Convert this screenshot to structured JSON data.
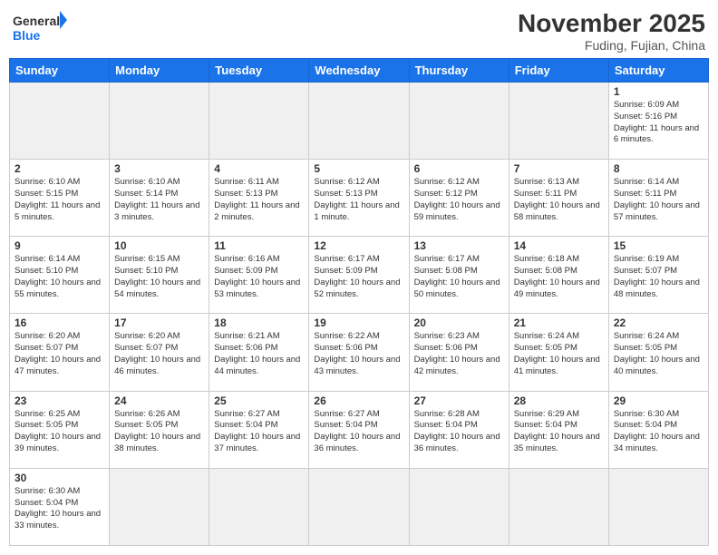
{
  "header": {
    "logo_general": "General",
    "logo_blue": "Blue",
    "month_title": "November 2025",
    "location": "Fuding, Fujian, China"
  },
  "weekdays": [
    "Sunday",
    "Monday",
    "Tuesday",
    "Wednesday",
    "Thursday",
    "Friday",
    "Saturday"
  ],
  "weeks": [
    [
      {
        "day": "",
        "info": "",
        "gray": true
      },
      {
        "day": "",
        "info": "",
        "gray": true
      },
      {
        "day": "",
        "info": "",
        "gray": true
      },
      {
        "day": "",
        "info": "",
        "gray": true
      },
      {
        "day": "",
        "info": "",
        "gray": true
      },
      {
        "day": "",
        "info": "",
        "gray": true
      },
      {
        "day": "1",
        "info": "Sunrise: 6:09 AM\nSunset: 5:16 PM\nDaylight: 11 hours and 6 minutes.",
        "gray": false
      }
    ],
    [
      {
        "day": "2",
        "info": "Sunrise: 6:10 AM\nSunset: 5:15 PM\nDaylight: 11 hours and 5 minutes.",
        "gray": false
      },
      {
        "day": "3",
        "info": "Sunrise: 6:10 AM\nSunset: 5:14 PM\nDaylight: 11 hours and 3 minutes.",
        "gray": false
      },
      {
        "day": "4",
        "info": "Sunrise: 6:11 AM\nSunset: 5:13 PM\nDaylight: 11 hours and 2 minutes.",
        "gray": false
      },
      {
        "day": "5",
        "info": "Sunrise: 6:12 AM\nSunset: 5:13 PM\nDaylight: 11 hours and 1 minute.",
        "gray": false
      },
      {
        "day": "6",
        "info": "Sunrise: 6:12 AM\nSunset: 5:12 PM\nDaylight: 10 hours and 59 minutes.",
        "gray": false
      },
      {
        "day": "7",
        "info": "Sunrise: 6:13 AM\nSunset: 5:11 PM\nDaylight: 10 hours and 58 minutes.",
        "gray": false
      },
      {
        "day": "8",
        "info": "Sunrise: 6:14 AM\nSunset: 5:11 PM\nDaylight: 10 hours and 57 minutes.",
        "gray": false
      }
    ],
    [
      {
        "day": "9",
        "info": "Sunrise: 6:14 AM\nSunset: 5:10 PM\nDaylight: 10 hours and 55 minutes.",
        "gray": false
      },
      {
        "day": "10",
        "info": "Sunrise: 6:15 AM\nSunset: 5:10 PM\nDaylight: 10 hours and 54 minutes.",
        "gray": false
      },
      {
        "day": "11",
        "info": "Sunrise: 6:16 AM\nSunset: 5:09 PM\nDaylight: 10 hours and 53 minutes.",
        "gray": false
      },
      {
        "day": "12",
        "info": "Sunrise: 6:17 AM\nSunset: 5:09 PM\nDaylight: 10 hours and 52 minutes.",
        "gray": false
      },
      {
        "day": "13",
        "info": "Sunrise: 6:17 AM\nSunset: 5:08 PM\nDaylight: 10 hours and 50 minutes.",
        "gray": false
      },
      {
        "day": "14",
        "info": "Sunrise: 6:18 AM\nSunset: 5:08 PM\nDaylight: 10 hours and 49 minutes.",
        "gray": false
      },
      {
        "day": "15",
        "info": "Sunrise: 6:19 AM\nSunset: 5:07 PM\nDaylight: 10 hours and 48 minutes.",
        "gray": false
      }
    ],
    [
      {
        "day": "16",
        "info": "Sunrise: 6:20 AM\nSunset: 5:07 PM\nDaylight: 10 hours and 47 minutes.",
        "gray": false
      },
      {
        "day": "17",
        "info": "Sunrise: 6:20 AM\nSunset: 5:07 PM\nDaylight: 10 hours and 46 minutes.",
        "gray": false
      },
      {
        "day": "18",
        "info": "Sunrise: 6:21 AM\nSunset: 5:06 PM\nDaylight: 10 hours and 44 minutes.",
        "gray": false
      },
      {
        "day": "19",
        "info": "Sunrise: 6:22 AM\nSunset: 5:06 PM\nDaylight: 10 hours and 43 minutes.",
        "gray": false
      },
      {
        "day": "20",
        "info": "Sunrise: 6:23 AM\nSunset: 5:06 PM\nDaylight: 10 hours and 42 minutes.",
        "gray": false
      },
      {
        "day": "21",
        "info": "Sunrise: 6:24 AM\nSunset: 5:05 PM\nDaylight: 10 hours and 41 minutes.",
        "gray": false
      },
      {
        "day": "22",
        "info": "Sunrise: 6:24 AM\nSunset: 5:05 PM\nDaylight: 10 hours and 40 minutes.",
        "gray": false
      }
    ],
    [
      {
        "day": "23",
        "info": "Sunrise: 6:25 AM\nSunset: 5:05 PM\nDaylight: 10 hours and 39 minutes.",
        "gray": false
      },
      {
        "day": "24",
        "info": "Sunrise: 6:26 AM\nSunset: 5:05 PM\nDaylight: 10 hours and 38 minutes.",
        "gray": false
      },
      {
        "day": "25",
        "info": "Sunrise: 6:27 AM\nSunset: 5:04 PM\nDaylight: 10 hours and 37 minutes.",
        "gray": false
      },
      {
        "day": "26",
        "info": "Sunrise: 6:27 AM\nSunset: 5:04 PM\nDaylight: 10 hours and 36 minutes.",
        "gray": false
      },
      {
        "day": "27",
        "info": "Sunrise: 6:28 AM\nSunset: 5:04 PM\nDaylight: 10 hours and 36 minutes.",
        "gray": false
      },
      {
        "day": "28",
        "info": "Sunrise: 6:29 AM\nSunset: 5:04 PM\nDaylight: 10 hours and 35 minutes.",
        "gray": false
      },
      {
        "day": "29",
        "info": "Sunrise: 6:30 AM\nSunset: 5:04 PM\nDaylight: 10 hours and 34 minutes.",
        "gray": false
      }
    ],
    [
      {
        "day": "30",
        "info": "Sunrise: 6:30 AM\nSunset: 5:04 PM\nDaylight: 10 hours and 33 minutes.",
        "gray": false
      },
      {
        "day": "",
        "info": "",
        "gray": true
      },
      {
        "day": "",
        "info": "",
        "gray": true
      },
      {
        "day": "",
        "info": "",
        "gray": true
      },
      {
        "day": "",
        "info": "",
        "gray": true
      },
      {
        "day": "",
        "info": "",
        "gray": true
      },
      {
        "day": "",
        "info": "",
        "gray": true
      }
    ]
  ]
}
